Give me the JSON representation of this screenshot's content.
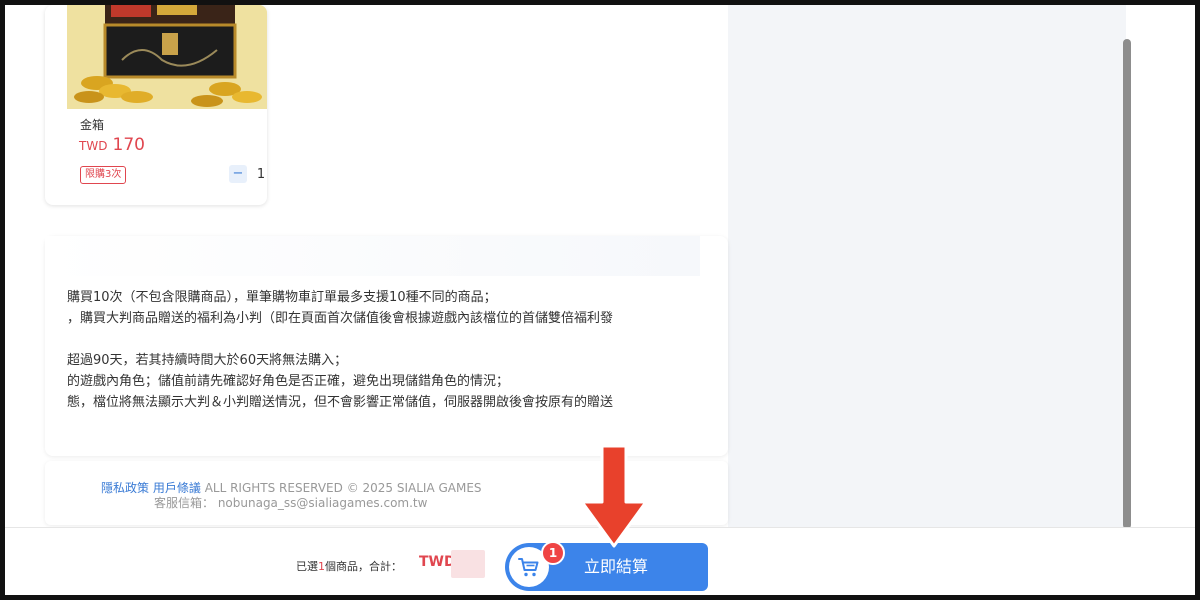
{
  "product": {
    "name": "金箱",
    "currency": "TWD",
    "price": "170",
    "limit_badge": "限購3次",
    "stepper": {
      "minus": "−",
      "quantity": "1",
      "plus": "+"
    }
  },
  "notes": {
    "lines": [
      "購買10次（不包含限購商品），單筆購物車訂單最多支援10種不同的商品；",
      "，購買大判商品贈送的福利為小判（即在頁面首次儲值後會根據遊戲內該檔位的首儲雙倍福利發",
      "超過90天，若其持續時間大於60天將無法購入；",
      "的遊戲內角色；儲值前請先確認好角色是否正確，避免出現儲錯角色的情況；",
      "態，檔位將無法顯示大判＆小判贈送情況，但不會影響正常儲值，伺服器開啟後會按原有的贈送"
    ]
  },
  "footer": {
    "privacy_link": "隱私政策",
    "terms_link": "用戶條議",
    "copyright": "ALL RIGHTS RESERVED © 2025 SIALIA GAMES",
    "support_email": "客服信箱： nobunaga_ss@sialiagames.com.tw"
  },
  "checkout": {
    "summary_prefix": "已選",
    "summary_count": "1",
    "summary_suffix": "個商品，合計：",
    "total_currency": "TWD",
    "cart_badge_count": "1",
    "button_label": "立即結算"
  },
  "colors": {
    "accent_blue": "#3c84ea",
    "price_red": "#e0464f",
    "badge_red": "#ef4444",
    "arrow_red": "#e8412c"
  },
  "icons": [
    "cart-icon",
    "down-arrow-annotation-icon"
  ]
}
